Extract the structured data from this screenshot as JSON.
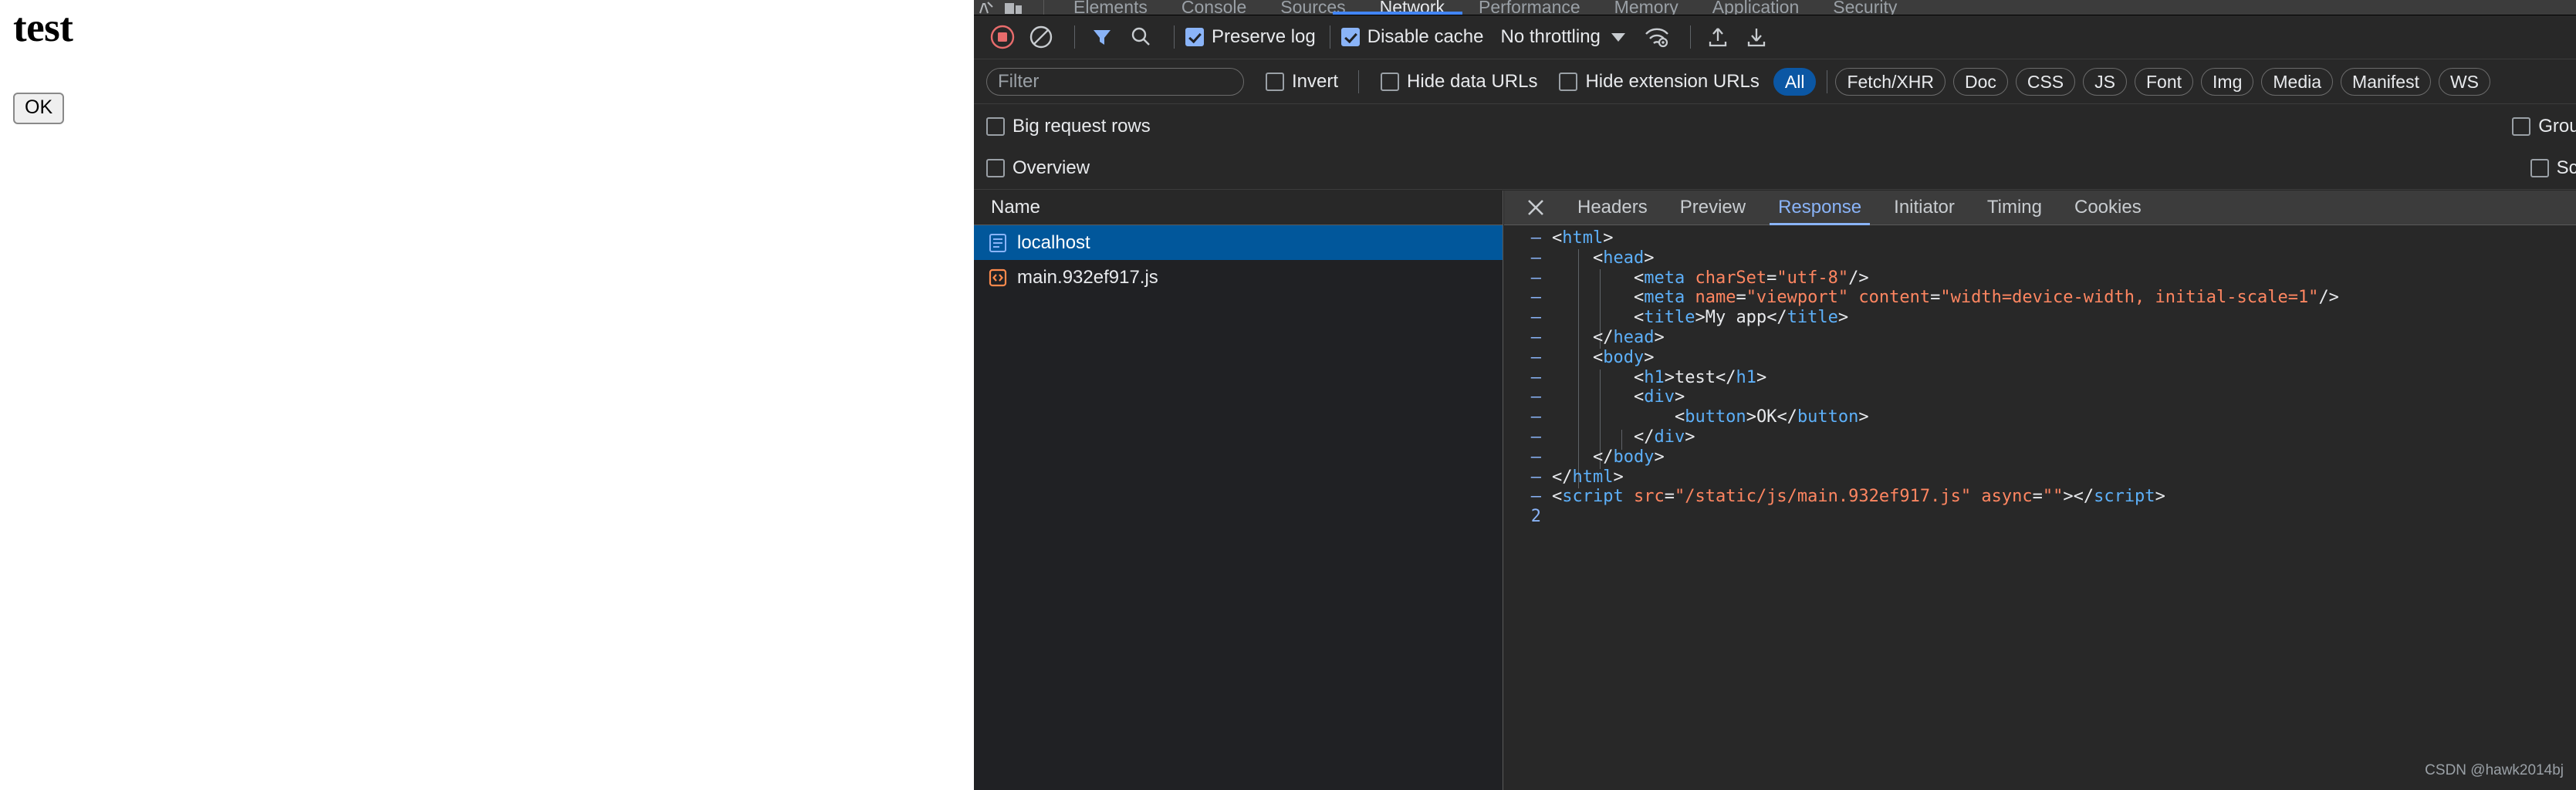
{
  "rendered_page": {
    "heading": "test",
    "button_label": "OK"
  },
  "devtools": {
    "top_tabs": [
      {
        "label": "Elements",
        "selected": false
      },
      {
        "label": "Console",
        "selected": false
      },
      {
        "label": "Sources",
        "selected": false
      },
      {
        "label": "Network",
        "selected": true
      },
      {
        "label": "Performance",
        "selected": false
      },
      {
        "label": "Memory",
        "selected": false
      },
      {
        "label": "Application",
        "selected": false
      },
      {
        "label": "Security",
        "selected": false
      }
    ],
    "toolbar": {
      "record_icon": "record-stop-icon",
      "clear_icon": "clear-icon",
      "filter_icon": "funnel-icon",
      "search_icon": "search-icon",
      "preserve_log_label": "Preserve log",
      "preserve_log_checked": true,
      "disable_cache_label": "Disable cache",
      "disable_cache_checked": true,
      "throttling_value": "No throttling",
      "throttling_caret_icon": "chevron-down-icon",
      "network_conditions_icon": "wifi-settings-icon",
      "import_har_icon": "upload-icon",
      "export_har_icon": "download-icon"
    },
    "filter_bar": {
      "filter_placeholder": "Filter",
      "filter_value": "",
      "invert_label": "Invert",
      "invert_checked": false,
      "hide_data_urls_label": "Hide data URLs",
      "hide_data_urls_checked": false,
      "hide_extension_urls_label": "Hide extension URLs",
      "hide_extension_urls_checked": false,
      "type_filters": [
        {
          "label": "All",
          "active": true
        },
        {
          "label": "Fetch/XHR",
          "active": false
        },
        {
          "label": "Doc",
          "active": false
        },
        {
          "label": "CSS",
          "active": false
        },
        {
          "label": "JS",
          "active": false
        },
        {
          "label": "Font",
          "active": false
        },
        {
          "label": "Img",
          "active": false
        },
        {
          "label": "Media",
          "active": false
        },
        {
          "label": "Manifest",
          "active": false
        },
        {
          "label": "WS",
          "active": false
        }
      ]
    },
    "options": {
      "big_request_rows_label": "Big request rows",
      "big_request_rows_checked": false,
      "overview_label": "Overview",
      "overview_checked": false,
      "group_by_frame_label": "Group by frame",
      "group_by_frame_checked": false,
      "screenshots_label": "Screenshots",
      "screenshots_checked": false
    },
    "request_list": {
      "column_header": "Name",
      "rows": [
        {
          "name": "localhost",
          "icon": "document-icon",
          "selected": true
        },
        {
          "name": "main.932ef917.js",
          "icon": "script-icon",
          "selected": false
        }
      ]
    },
    "detail": {
      "close_icon": "close-icon",
      "tabs": [
        {
          "label": "Headers",
          "active": false
        },
        {
          "label": "Preview",
          "active": false
        },
        {
          "label": "Response",
          "active": true
        },
        {
          "label": "Initiator",
          "active": false
        },
        {
          "label": "Timing",
          "active": false
        },
        {
          "label": "Cookies",
          "active": false
        }
      ],
      "code_lines": [
        {
          "gutter": "–",
          "indent": 0,
          "tokens": [
            {
              "t": "punc",
              "s": "<"
            },
            {
              "t": "tag",
              "s": "html"
            },
            {
              "t": "punc",
              "s": ">"
            }
          ]
        },
        {
          "gutter": "–",
          "indent": 1,
          "tokens": [
            {
              "t": "punc",
              "s": "<"
            },
            {
              "t": "tag",
              "s": "head"
            },
            {
              "t": "punc",
              "s": ">"
            }
          ]
        },
        {
          "gutter": "–",
          "indent": 2,
          "tokens": [
            {
              "t": "punc",
              "s": "<"
            },
            {
              "t": "tag",
              "s": "meta"
            },
            {
              "t": "punc",
              "s": " "
            },
            {
              "t": "attr",
              "s": "charSet"
            },
            {
              "t": "punc",
              "s": "="
            },
            {
              "t": "val",
              "s": "\"utf-8\""
            },
            {
              "t": "punc",
              "s": "/>"
            }
          ]
        },
        {
          "gutter": "–",
          "indent": 2,
          "tokens": [
            {
              "t": "punc",
              "s": "<"
            },
            {
              "t": "tag",
              "s": "meta"
            },
            {
              "t": "punc",
              "s": " "
            },
            {
              "t": "attr",
              "s": "name"
            },
            {
              "t": "punc",
              "s": "="
            },
            {
              "t": "val",
              "s": "\"viewport\""
            },
            {
              "t": "punc",
              "s": " "
            },
            {
              "t": "attr",
              "s": "content"
            },
            {
              "t": "punc",
              "s": "="
            },
            {
              "t": "val",
              "s": "\"width=device-width, initial-scale=1\""
            },
            {
              "t": "punc",
              "s": "/>"
            }
          ]
        },
        {
          "gutter": "–",
          "indent": 2,
          "tokens": [
            {
              "t": "punc",
              "s": "<"
            },
            {
              "t": "tag",
              "s": "title"
            },
            {
              "t": "punc",
              "s": ">"
            },
            {
              "t": "txt",
              "s": "My app"
            },
            {
              "t": "punc",
              "s": "</"
            },
            {
              "t": "tag",
              "s": "title"
            },
            {
              "t": "punc",
              "s": ">"
            }
          ]
        },
        {
          "gutter": "–",
          "indent": 1,
          "tokens": [
            {
              "t": "punc",
              "s": "</"
            },
            {
              "t": "tag",
              "s": "head"
            },
            {
              "t": "punc",
              "s": ">"
            }
          ]
        },
        {
          "gutter": "–",
          "indent": 1,
          "tokens": [
            {
              "t": "punc",
              "s": "<"
            },
            {
              "t": "tag",
              "s": "body"
            },
            {
              "t": "punc",
              "s": ">"
            }
          ]
        },
        {
          "gutter": "–",
          "indent": 2,
          "tokens": [
            {
              "t": "punc",
              "s": "<"
            },
            {
              "t": "tag",
              "s": "h1"
            },
            {
              "t": "punc",
              "s": ">"
            },
            {
              "t": "txt",
              "s": "test"
            },
            {
              "t": "punc",
              "s": "</"
            },
            {
              "t": "tag",
              "s": "h1"
            },
            {
              "t": "punc",
              "s": ">"
            }
          ]
        },
        {
          "gutter": "–",
          "indent": 2,
          "tokens": [
            {
              "t": "punc",
              "s": "<"
            },
            {
              "t": "tag",
              "s": "div"
            },
            {
              "t": "punc",
              "s": ">"
            }
          ]
        },
        {
          "gutter": "–",
          "indent": 3,
          "tokens": [
            {
              "t": "punc",
              "s": "<"
            },
            {
              "t": "tag",
              "s": "button"
            },
            {
              "t": "punc",
              "s": ">"
            },
            {
              "t": "txt",
              "s": "OK"
            },
            {
              "t": "punc",
              "s": "</"
            },
            {
              "t": "tag",
              "s": "button"
            },
            {
              "t": "punc",
              "s": ">"
            }
          ]
        },
        {
          "gutter": "–",
          "indent": 2,
          "tokens": [
            {
              "t": "punc",
              "s": "</"
            },
            {
              "t": "tag",
              "s": "div"
            },
            {
              "t": "punc",
              "s": ">"
            }
          ]
        },
        {
          "gutter": "–",
          "indent": 1,
          "tokens": [
            {
              "t": "punc",
              "s": "</"
            },
            {
              "t": "tag",
              "s": "body"
            },
            {
              "t": "punc",
              "s": ">"
            }
          ]
        },
        {
          "gutter": "–",
          "indent": 0,
          "tokens": [
            {
              "t": "punc",
              "s": "</"
            },
            {
              "t": "tag",
              "s": "html"
            },
            {
              "t": "punc",
              "s": ">"
            }
          ]
        },
        {
          "gutter": "–",
          "indent": 0,
          "tokens": [
            {
              "t": "punc",
              "s": "<"
            },
            {
              "t": "tag",
              "s": "script"
            },
            {
              "t": "punc",
              "s": " "
            },
            {
              "t": "attr",
              "s": "src"
            },
            {
              "t": "punc",
              "s": "="
            },
            {
              "t": "val",
              "s": "\"/static/js/main.932ef917.js\""
            },
            {
              "t": "punc",
              "s": " "
            },
            {
              "t": "attr",
              "s": "async"
            },
            {
              "t": "punc",
              "s": "="
            },
            {
              "t": "val",
              "s": "\"\""
            },
            {
              "t": "punc",
              "s": ">"
            },
            {
              "t": "punc",
              "s": "</"
            },
            {
              "t": "tag",
              "s": "script"
            },
            {
              "t": "punc",
              "s": ">"
            }
          ]
        },
        {
          "gutter": "2",
          "indent": 0,
          "tokens": []
        }
      ]
    },
    "watermark": "CSDN @hawk2014bj"
  },
  "colors": {
    "accent_blue": "#8ab4f8",
    "tab_underline": "#4285f4",
    "selected_row": "#01579b",
    "active_pill": "#0b57a4",
    "record_red": "#e86c6c",
    "tag_blue": "#5db0f9",
    "attr_orange": "#ff8661",
    "panel_bg": "#282828",
    "list_bg": "#202124"
  }
}
